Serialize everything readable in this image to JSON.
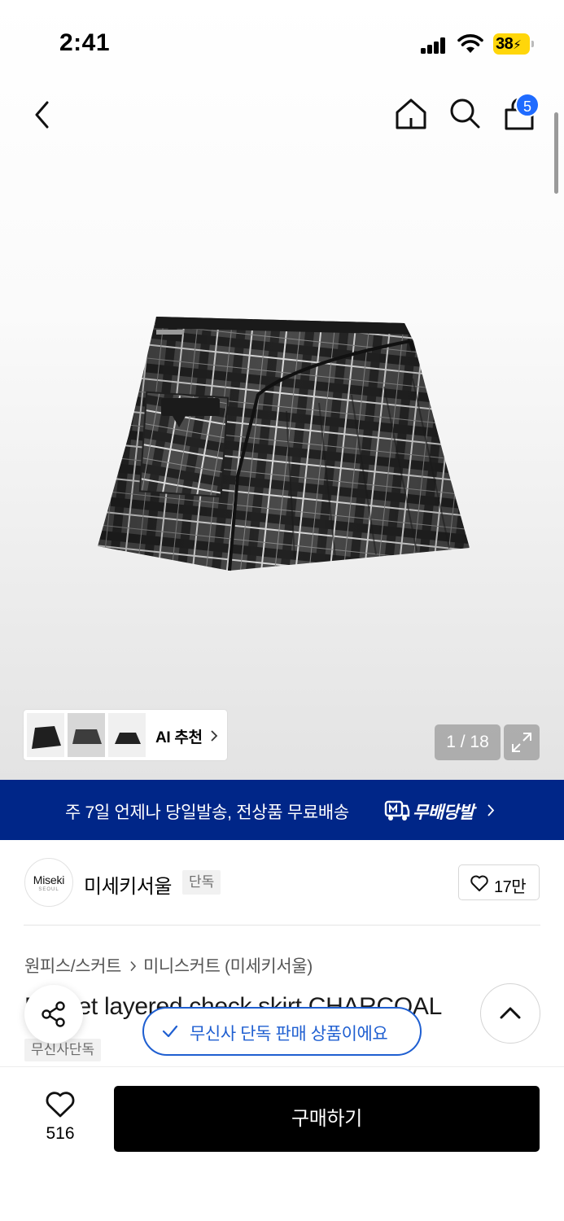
{
  "status_bar": {
    "time": "2:41",
    "battery": "38"
  },
  "header": {
    "cart_count": "5"
  },
  "gallery": {
    "ai_recommend_label": "AI 추천",
    "counter": "1 / 18"
  },
  "banner": {
    "text": "주 7일 언제나 당일발송, 전상품 무료배송",
    "logo_text": "무배당발"
  },
  "brand": {
    "logo_text": "Miseki",
    "logo_subtext": "SEOUL",
    "name": "미세키서울",
    "tag": "단독",
    "like_count": "17만"
  },
  "breadcrumb": {
    "category": "원피스/스커트",
    "subcategory": "미니스커트 (미세키서울)"
  },
  "product": {
    "title": "Pocket layered check skirt CHARCOAL",
    "tag": "무신사단독"
  },
  "toast": {
    "text": "무신사 단독 판매 상품이에요"
  },
  "bottom": {
    "wish_count": "516",
    "buy_label": "구매하기"
  },
  "colors": {
    "banner_bg": "#002688",
    "accent_blue": "#1f5fd1",
    "badge_blue": "#1f6bff",
    "battery_yellow": "#ffd60a"
  }
}
